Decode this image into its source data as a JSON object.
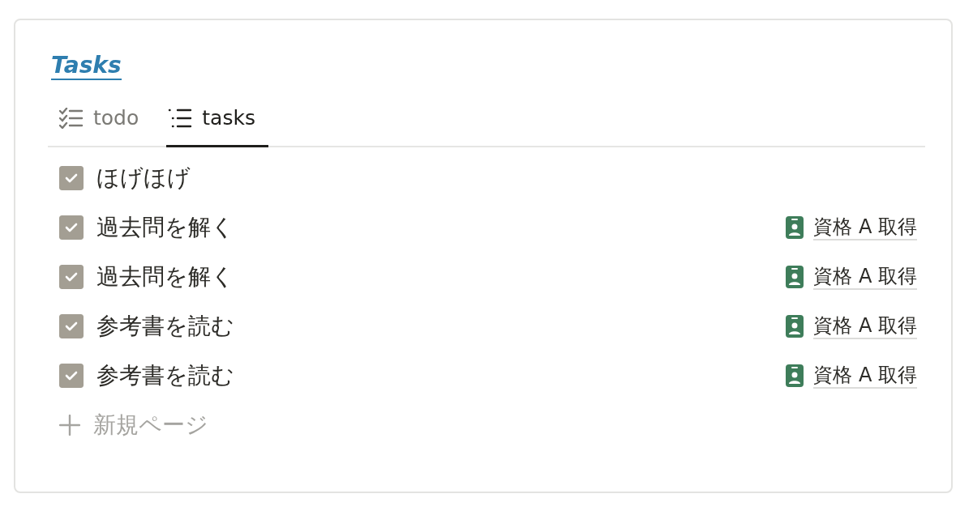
{
  "title": "Tasks",
  "tabs": [
    {
      "label": "todo",
      "kind": "checklist",
      "selected": false
    },
    {
      "label": "tasks",
      "kind": "list",
      "selected": true
    }
  ],
  "items": [
    {
      "title": "ほげほげ",
      "checked": true
    },
    {
      "title": "過去問を解く",
      "checked": true,
      "relation": "資格 A 取得"
    },
    {
      "title": "過去問を解く",
      "checked": true,
      "relation": "資格 A 取得"
    },
    {
      "title": "参考書を読む",
      "checked": true,
      "relation": "資格 A 取得"
    },
    {
      "title": "参考書を読む",
      "checked": true,
      "relation": "資格 A 取得"
    }
  ],
  "new_page": {
    "label": "新規ページ"
  }
}
